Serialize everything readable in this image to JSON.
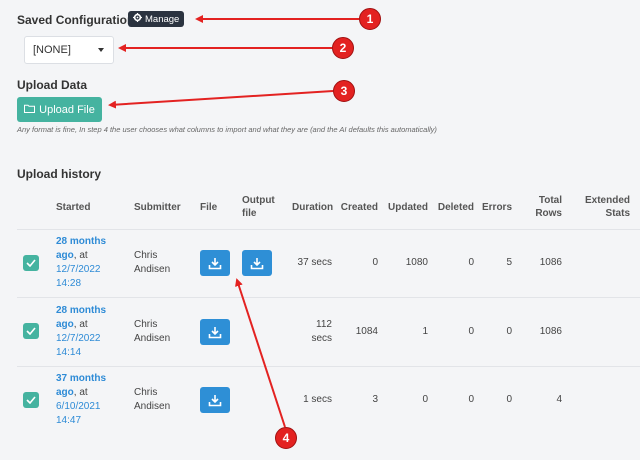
{
  "saved_config": {
    "title": "Saved Configurations",
    "manage_label": "Manage",
    "selected": "[NONE]"
  },
  "upload": {
    "title": "Upload Data",
    "button_label": "Upload File",
    "hint": "Any format is fine, In step 4 the user chooses what columns to import and what they are (and the AI defaults this automatically)"
  },
  "history": {
    "title": "Upload history",
    "columns": {
      "started": "Started",
      "submitter": "Submitter",
      "file": "File",
      "output_1": "Output",
      "output_2": "file",
      "duration": "Duration",
      "created": "Created",
      "updated": "Updated",
      "deleted": "Deleted",
      "errors": "Errors",
      "total_1": "Total",
      "total_2": "Rows",
      "extended_1": "Extended",
      "extended_2": "Stats"
    },
    "rows": [
      {
        "rel_1": "28 months",
        "rel_2": "ago",
        "at": ", at",
        "date": "12/7/2022",
        "time": "14:28",
        "submitter_1": "Chris",
        "submitter_2": "Andisen",
        "duration_1": "37 secs",
        "duration_2": "",
        "created": "0",
        "updated": "1080",
        "deleted": "0",
        "errors": "5",
        "total": "1086"
      },
      {
        "rel_1": "28 months",
        "rel_2": "ago",
        "at": ", at",
        "date": "12/7/2022",
        "time": "14:14",
        "submitter_1": "Chris",
        "submitter_2": "Andisen",
        "duration_1": "112",
        "duration_2": "secs",
        "created": "1084",
        "updated": "1",
        "deleted": "0",
        "errors": "0",
        "total": "1086"
      },
      {
        "rel_1": "37 months",
        "rel_2": "ago",
        "at": ", at",
        "date": "6/10/2021",
        "time": "14:47",
        "submitter_1": "Chris",
        "submitter_2": "Andisen",
        "duration_1": "1 secs",
        "duration_2": "",
        "created": "3",
        "updated": "0",
        "deleted": "0",
        "errors": "0",
        "total": "4"
      }
    ]
  },
  "callouts": [
    "1",
    "2",
    "3",
    "4"
  ],
  "colors": {
    "accent_green": "#45b3a0",
    "link_blue": "#2e8bd6",
    "callout_red": "#e32221",
    "button_blue": "#2e8fd6"
  },
  "icons": {
    "manage": "gear-icon",
    "upload": "folder-icon",
    "download": "download-icon",
    "row_check": "check-icon"
  }
}
